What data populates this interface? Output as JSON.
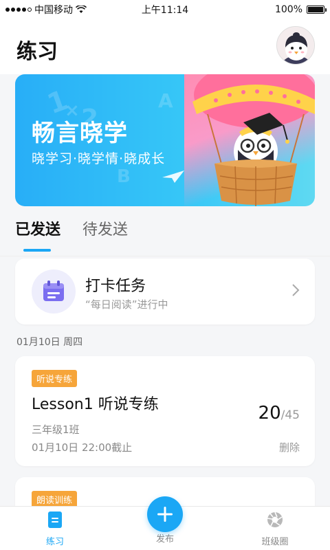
{
  "status_bar": {
    "carrier": "中国移动",
    "time": "上午11:14",
    "battery": "100%"
  },
  "header": {
    "title": "练习"
  },
  "banner": {
    "title": "畅言晓学",
    "subtitle": "晓学习·晓学情·晓成长"
  },
  "tabs": [
    {
      "label": "已发送",
      "active": true
    },
    {
      "label": "待发送",
      "active": false
    }
  ],
  "checkin_card": {
    "title": "打卡任务",
    "subtitle": "“每日阅读”进行中",
    "icon": "calendar-icon"
  },
  "date_group": {
    "label": "01月10日  周四"
  },
  "assignments": [
    {
      "tag": "听说专练",
      "title": "Lesson1 听说专练",
      "class": "三年级1班",
      "deadline": "01月10日  22:00截止",
      "done": "20",
      "separator": "/",
      "total": "45",
      "delete_label": "删除"
    },
    {
      "tag": "朗读训练"
    }
  ],
  "tab_bar": {
    "items": [
      {
        "label": "练习",
        "icon": "practice-icon",
        "active": true
      },
      {
        "label": "发布",
        "icon": "plus-icon",
        "active": false
      },
      {
        "label": "班级圈",
        "icon": "aperture-icon",
        "active": false
      }
    ]
  },
  "colors": {
    "accent": "#1ba7f5",
    "tag_orange": "#f6a53a",
    "banner_blue": "#28aef7",
    "checkin_purple": "#7b6ef0"
  }
}
